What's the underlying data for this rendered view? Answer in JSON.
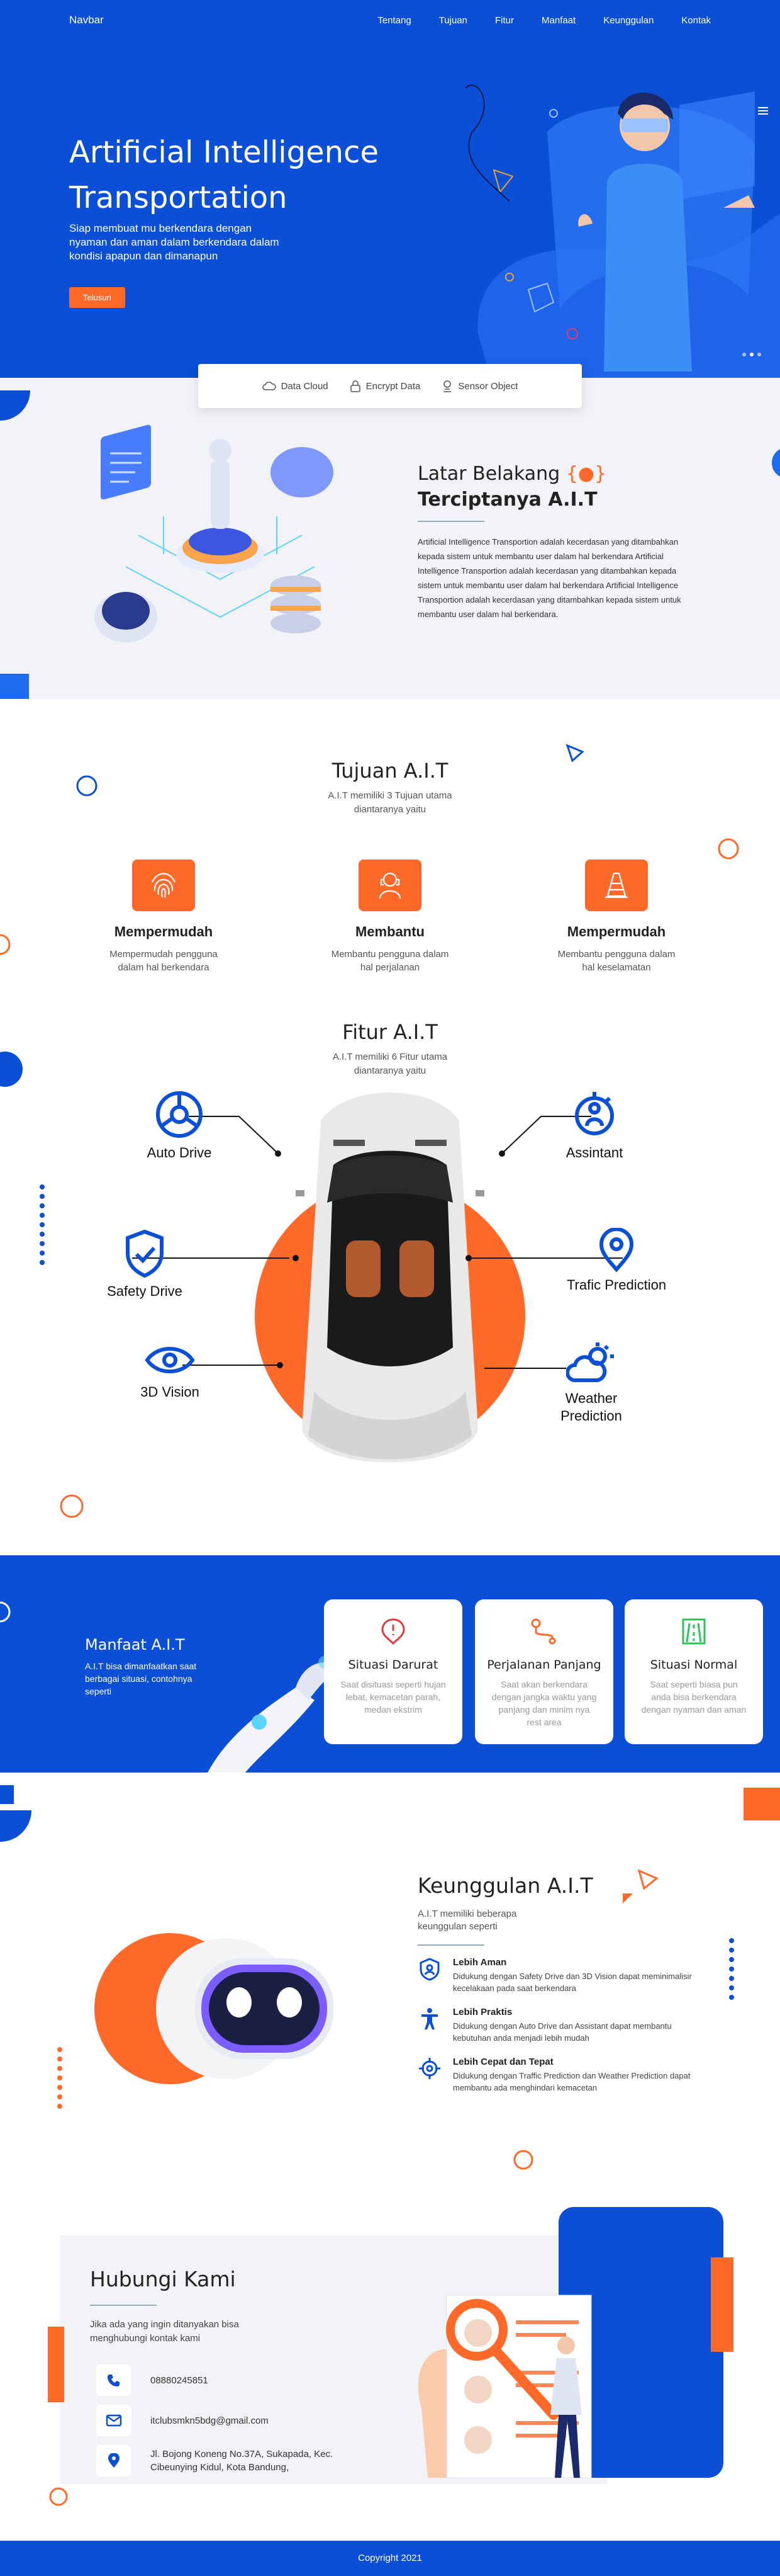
{
  "nav": {
    "brand": "Navbar",
    "links": [
      "Tentang",
      "Tujuan",
      "Fitur",
      "Manfaat",
      "Keunggulan",
      "Kontak"
    ]
  },
  "hero": {
    "title": "Artificial Intelligence Transportation",
    "subtitle": "Siap membuat mu berkendara dengan nyaman dan aman dalam berkendara dalam kondisi apapun dan dimanapun",
    "button": "Telusuri"
  },
  "features_bar": [
    "Data Cloud",
    "Encrypt Data",
    "Sensor Object"
  ],
  "latar": {
    "title_prefix": "Latar Belakang",
    "title_mark": "{●}",
    "title_bold": "Terciptanya A.I.T",
    "body": "Artificial Intelligence Transportion adalah kecerdasan yang ditambahkan kepada sistem untuk membantu user dalam hal berkendara Artificial Intelligence Transportion adalah kecerdasan yang ditambahkan kepada sistem untuk membantu user dalam hal berkendara Artificial Intelligence Transportion adalah kecerdasan yang ditambahkan kepada sistem untuk membantu user dalam hal berkendara."
  },
  "tujuan": {
    "title": "Tujuan A.I.T",
    "subtitle": "A.I.T memiliki 3 Tujuan utama diantaranya yaitu",
    "items": [
      {
        "title": "Mempermudah",
        "desc": "Mempermudah pengguna dalam hal berkendara",
        "icon": "fingerprint-icon"
      },
      {
        "title": "Membantu",
        "desc": "Membantu pengguna dalam hal perjalanan",
        "icon": "user-assist-icon"
      },
      {
        "title": "Mempermudah",
        "desc": "Membantu pengguna dalam hal keselamatan",
        "icon": "traffic-cone-icon"
      }
    ]
  },
  "fitur": {
    "title": "Fitur A.I.T",
    "subtitle": "A.I.T memiliki 6 Fitur utama diantaranya yaitu",
    "items": [
      "Auto Drive",
      "Assintant",
      "Safety Drive",
      "Trafic Prediction",
      "3D Vision",
      "Weather Prediction"
    ]
  },
  "manfaat": {
    "title": "Manfaat A.I.T",
    "desc": "A.I.T bisa dimanfaatkan saat berbagai situasi, contohnya seperti",
    "cards": [
      {
        "title": "Situasi Darurat",
        "desc": "Saat disituasi seperti hujan lebat, kemacetan parah, medan ekstrim"
      },
      {
        "title": "Perjalanan Panjang",
        "desc": "Saat akan berkendara dengan jangka waktu yang panjang dan minim nya rest area"
      },
      {
        "title": "Situasi Normal",
        "desc": "Saat seperti biasa pun anda bisa berkendara dengan nyaman dan aman"
      }
    ]
  },
  "keunggulan": {
    "title": "Keunggulan A.I.T",
    "subtitle": "A.I.T memiliki beberapa keunggulan seperti",
    "items": [
      {
        "title": "Lebih Aman",
        "desc": "Didukung dengan Safety Drive dan 3D Vision dapat meminimalisir kecelakaan pada saat berkendara"
      },
      {
        "title": "Lebih Praktis",
        "desc": "Didukung dengan Auto Drive dan Assistant dapat membantu kebutuhan anda menjadi lebih mudah"
      },
      {
        "title": "Lebih Cepat dan Tepat",
        "desc": "Didukung dengan Traffic Prediction dan Weather Prediction dapat membantu ada menghindari kemacetan"
      }
    ]
  },
  "kontak": {
    "title": "Hubungi Kami",
    "subtitle": "Jika ada yang ingin ditanyakan bisa menghubungi kontak kami",
    "phone": "08880245851",
    "email": "itclubsmkn5bdg@gmail.com",
    "address": "Jl. Bojong Koneng No.37A, Sukapada, Kec. Cibeunying Kidul, Kota Bandung,"
  },
  "footer": "Copyright 2021",
  "colors": {
    "primary": "#0a4fd6",
    "accent": "#ff6a2b",
    "light_bg": "#f1f3f7"
  }
}
